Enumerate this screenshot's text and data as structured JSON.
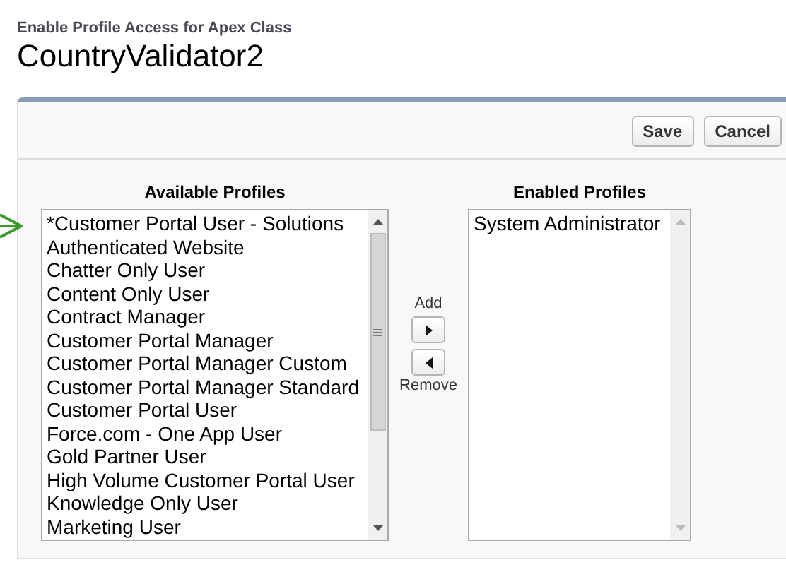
{
  "header": {
    "subtitle": "Enable Profile Access for Apex Class",
    "title": "CountryValidator2"
  },
  "buttons": [
    {
      "label": "Save"
    },
    {
      "label": "Cancel"
    }
  ],
  "available": {
    "heading": "Available Profiles",
    "items": [
      "*Customer Portal User - Solutions",
      "Authenticated Website",
      "Chatter Only User",
      "Content Only User",
      "Contract Manager",
      "Customer Portal Manager",
      "Customer Portal Manager Custom",
      "Customer Portal Manager Standard",
      "Customer Portal User",
      "Force.com - One App User",
      "Gold Partner User",
      "High Volume Customer Portal User",
      "Knowledge Only User",
      "Marketing User"
    ]
  },
  "transfer": {
    "add_label": "Add",
    "remove_label": "Remove"
  },
  "enabled": {
    "heading": "Enabled Profiles",
    "items": [
      "System Administrator"
    ]
  }
}
